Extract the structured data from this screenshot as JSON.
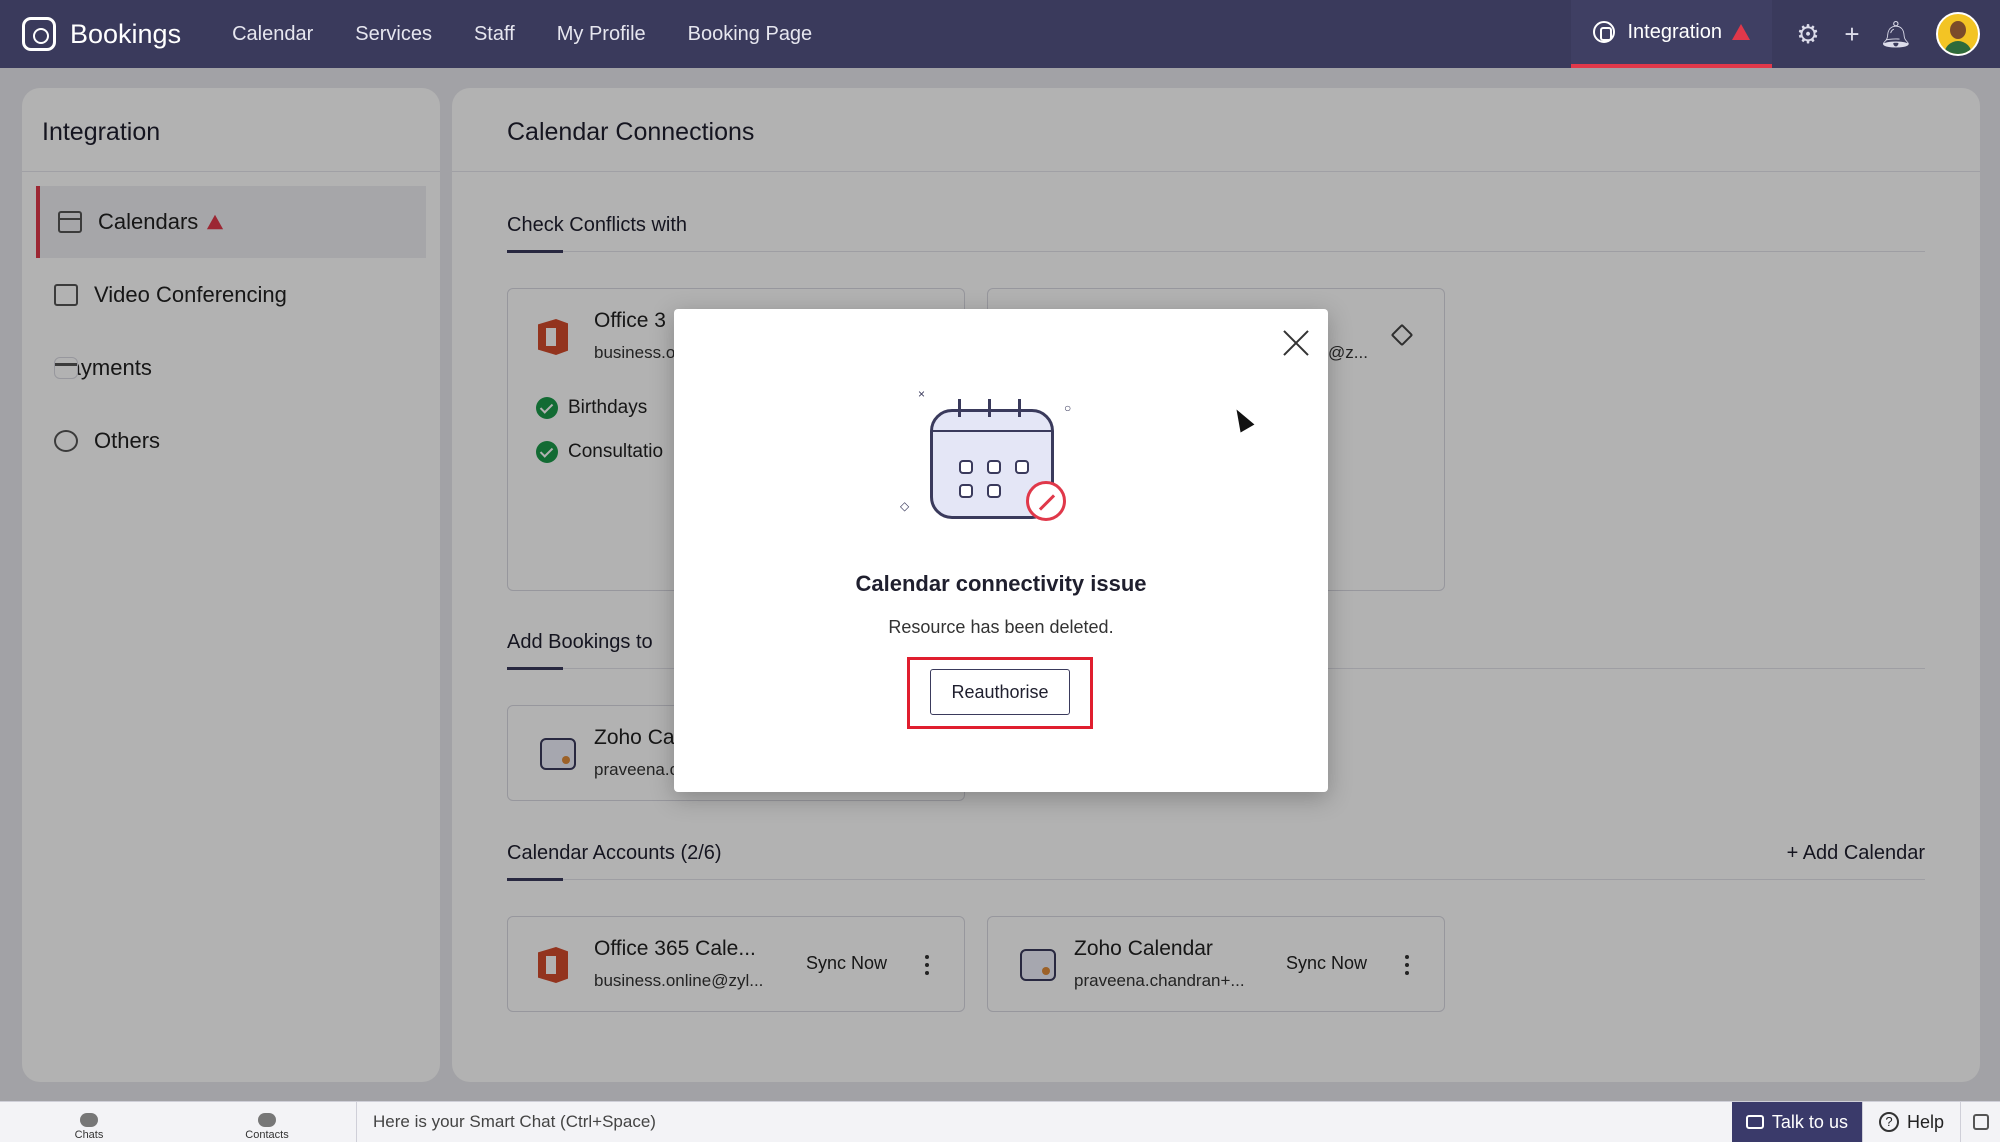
{
  "app": {
    "name": "Bookings"
  },
  "nav": {
    "items": [
      {
        "label": "Calendar"
      },
      {
        "label": "Services"
      },
      {
        "label": "Staff"
      },
      {
        "label": "My Profile"
      },
      {
        "label": "Booking Page"
      }
    ],
    "integration_label": "Integration"
  },
  "sidebar": {
    "title": "Integration",
    "items": [
      {
        "label": "Calendars",
        "icon": "calendar-icon",
        "active": true,
        "warning": true
      },
      {
        "label": "Video Conferencing",
        "icon": "video-icon"
      },
      {
        "label": "Payments",
        "icon": "card-icon"
      },
      {
        "label": "Others",
        "icon": "plug-icon"
      }
    ]
  },
  "main": {
    "title": "Calendar Connections",
    "check_conflicts": {
      "heading": "Check Conflicts with",
      "card1": {
        "title": "Office 3",
        "sub": "business.o",
        "items": [
          "Birthdays",
          "Consultatio"
        ]
      },
      "card2": {
        "sub": "@z..."
      }
    },
    "add_bookings": {
      "heading": "Add Bookings to",
      "card": {
        "title": "Zoho Ca",
        "sub": "praveena.c"
      }
    },
    "accounts": {
      "heading": "Calendar Accounts (2/6)",
      "add_label": "+ Add Calendar",
      "cards": [
        {
          "title": "Office 365 Cale...",
          "sub": "business.online@zyl...",
          "action": "Sync Now"
        },
        {
          "title": "Zoho Calendar",
          "sub": "praveena.chandran+...",
          "action": "Sync Now"
        }
      ]
    }
  },
  "modal": {
    "title": "Calendar connectivity issue",
    "message": "Resource has been deleted.",
    "button": "Reauthorise"
  },
  "bottom_bar": {
    "chats": "Chats",
    "contacts": "Contacts",
    "smart_chat_placeholder": "Here is your Smart Chat (Ctrl+Space)",
    "talk": "Talk to us",
    "help": "Help"
  },
  "colors": {
    "topbar": "#3a3a5c",
    "accent_red": "#e0384a",
    "success_green": "#1a9a4a"
  }
}
